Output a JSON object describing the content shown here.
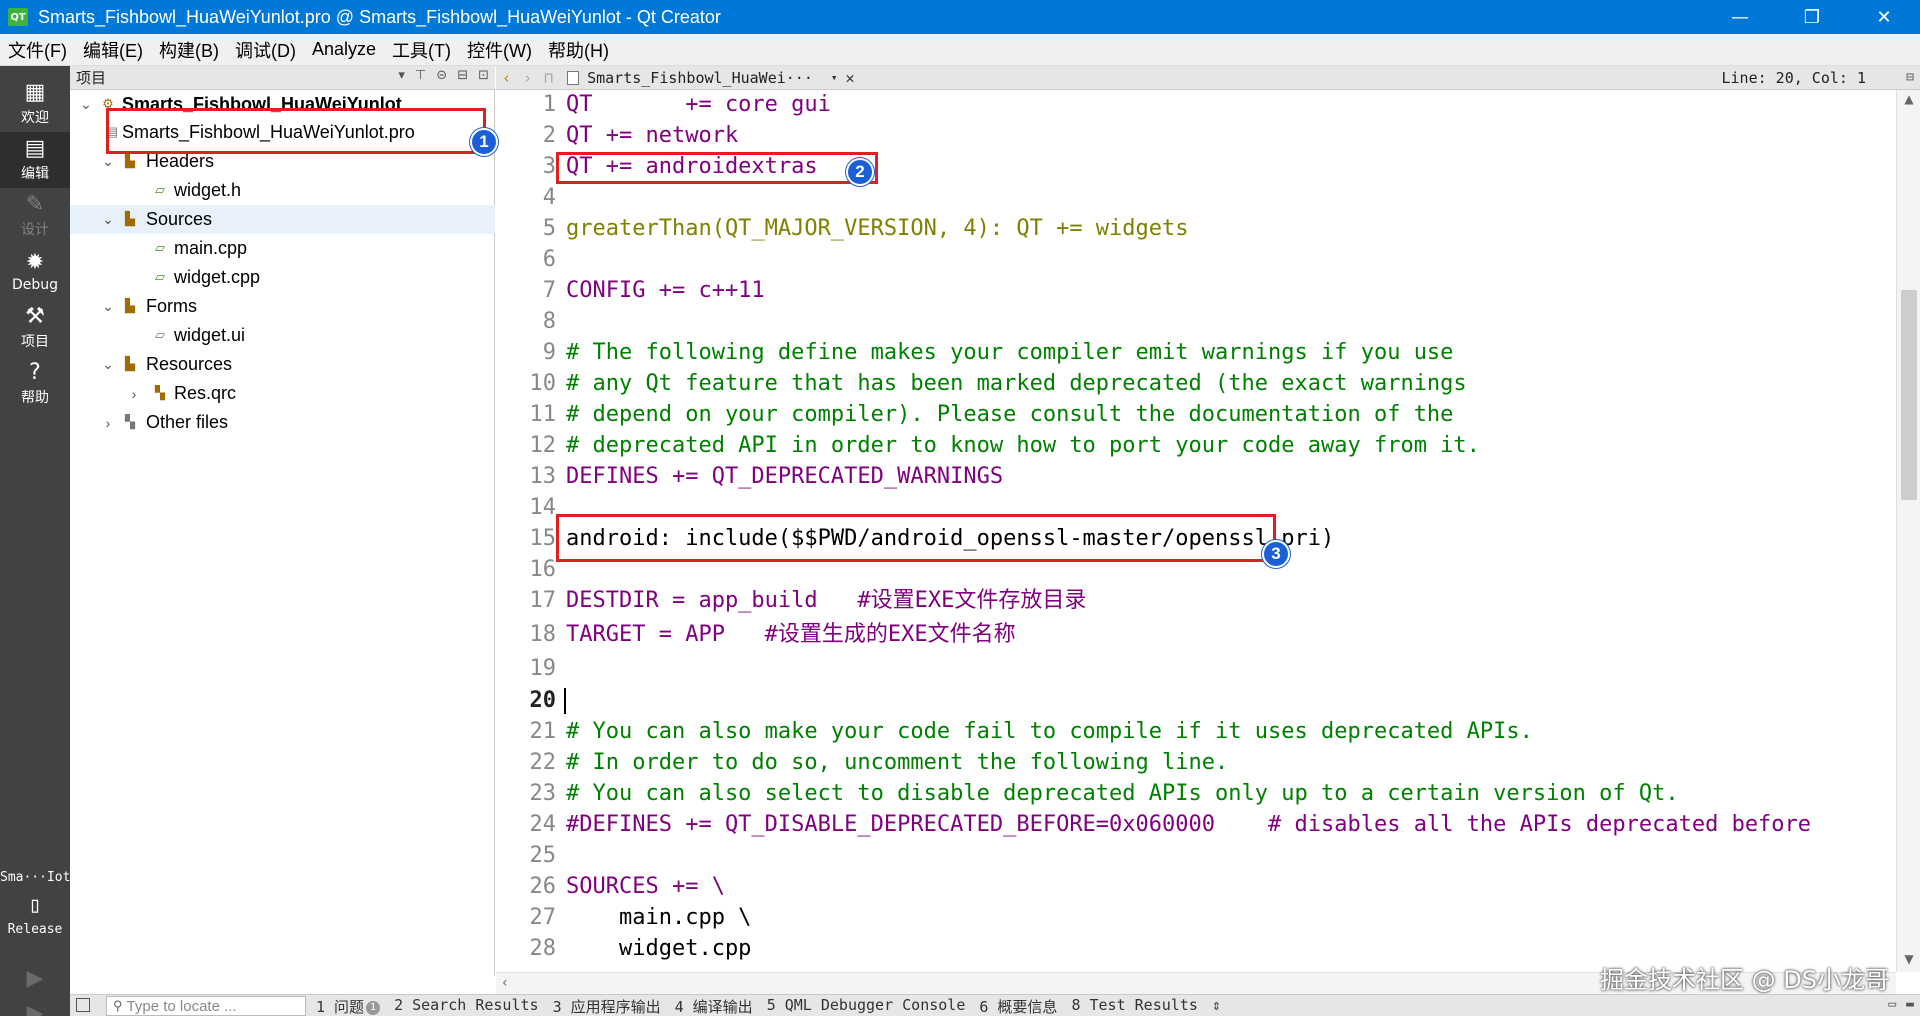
{
  "window": {
    "title": "Smarts_Fishbowl_HuaWeiYunlot.pro @ Smarts_Fishbowl_HuaWeiYunlot - Qt Creator",
    "app_icon_text": "QT",
    "minimize": "—",
    "maximize": "❐",
    "close": "✕"
  },
  "menu": [
    "文件(F)",
    "编辑(E)",
    "构建(B)",
    "调试(D)",
    "Analyze",
    "工具(T)",
    "控件(W)",
    "帮助(H)"
  ],
  "modes": [
    {
      "label": "欢迎",
      "icon": "grid-icon"
    },
    {
      "label": "编辑",
      "icon": "edit-icon"
    },
    {
      "label": "设计",
      "icon": "design-pencil-icon"
    },
    {
      "label": "Debug",
      "icon": "bug-icon"
    },
    {
      "label": "项目",
      "icon": "wrench-icon"
    },
    {
      "label": "帮助",
      "icon": "help-icon"
    }
  ],
  "kit": {
    "name": "Sma···Iot",
    "config": "Release"
  },
  "project_panel": {
    "header": "项目"
  },
  "tree": {
    "root": "Smarts_Fishbowl_HuaWeiYunlot",
    "pro_file": "Smarts_Fishbowl_HuaWeiYunlot.pro",
    "headers": "Headers",
    "widget_h": "widget.h",
    "sources": "Sources",
    "main_cpp": "main.cpp",
    "widget_cpp": "widget.cpp",
    "forms": "Forms",
    "widget_ui": "widget.ui",
    "resources": "Resources",
    "res_qrc": "Res.qrc",
    "other": "Other files"
  },
  "editor_toolbar": {
    "file": "Smarts_Fishbowl_HuaWei···",
    "position": "Line: 20, Col: 1"
  },
  "code_lines": [
    {
      "n": "1",
      "t": "QT       += core gui"
    },
    {
      "n": "2",
      "t": "QT += network"
    },
    {
      "n": "3",
      "t": "QT += androidextras"
    },
    {
      "n": "4",
      "t": ""
    },
    {
      "n": "5",
      "t": "greaterThan(QT_MAJOR_VERSION, 4): QT += widgets"
    },
    {
      "n": "6",
      "t": ""
    },
    {
      "n": "7",
      "t": "CONFIG += c++11"
    },
    {
      "n": "8",
      "t": ""
    },
    {
      "n": "9",
      "t": "# The following define makes your compiler emit warnings if you use"
    },
    {
      "n": "10",
      "t": "# any Qt feature that has been marked deprecated (the exact warnings"
    },
    {
      "n": "11",
      "t": "# depend on your compiler). Please consult the documentation of the"
    },
    {
      "n": "12",
      "t": "# deprecated API in order to know how to port your code away from it."
    },
    {
      "n": "13",
      "t": "DEFINES += QT_DEPRECATED_WARNINGS"
    },
    {
      "n": "14",
      "t": ""
    },
    {
      "n": "15",
      "t": "android: include($$PWD/android_openssl-master/openssl.pri)"
    },
    {
      "n": "16",
      "t": ""
    },
    {
      "n": "17",
      "t": "DESTDIR = app_build   #设置EXE文件存放目录"
    },
    {
      "n": "18",
      "t": "TARGET = APP   #设置生成的EXE文件名称"
    },
    {
      "n": "19",
      "t": ""
    },
    {
      "n": "20",
      "t": ""
    },
    {
      "n": "21",
      "t": "# You can also make your code fail to compile if it uses deprecated APIs."
    },
    {
      "n": "22",
      "t": "# In order to do so, uncomment the following line."
    },
    {
      "n": "23",
      "t": "# You can also select to disable deprecated APIs only up to a certain version of Qt."
    },
    {
      "n": "24",
      "t": "#DEFINES += QT_DISABLE_DEPRECATED_BEFORE=0x060000    # disables all the APIs deprecated before"
    },
    {
      "n": "25",
      "t": ""
    },
    {
      "n": "26",
      "t": "SOURCES += \\"
    },
    {
      "n": "27",
      "t": "    main.cpp \\"
    },
    {
      "n": "28",
      "t": "    widget.cpp"
    }
  ],
  "status": {
    "locator_placeholder": "Type to locate ...",
    "panes": [
      "1 问题",
      "2 Search Results",
      "3 应用程序输出",
      "4 编译输出",
      "5 QML Debugger Console",
      "6 概要信息",
      "8 Test Results"
    ],
    "issues_badge": "1",
    "more": "⇕"
  },
  "annotations": [
    "1",
    "2",
    "3"
  ],
  "watermark": "掘金技术社区 @ DS小龙哥",
  "colors": {
    "titlebar": "#0078d7",
    "modebar": "#404244",
    "annotation_box": "#e02020",
    "annotation_badge": "#1a5fd6",
    "keyword": "#800080",
    "function": "#808000",
    "comment": "#008000"
  }
}
